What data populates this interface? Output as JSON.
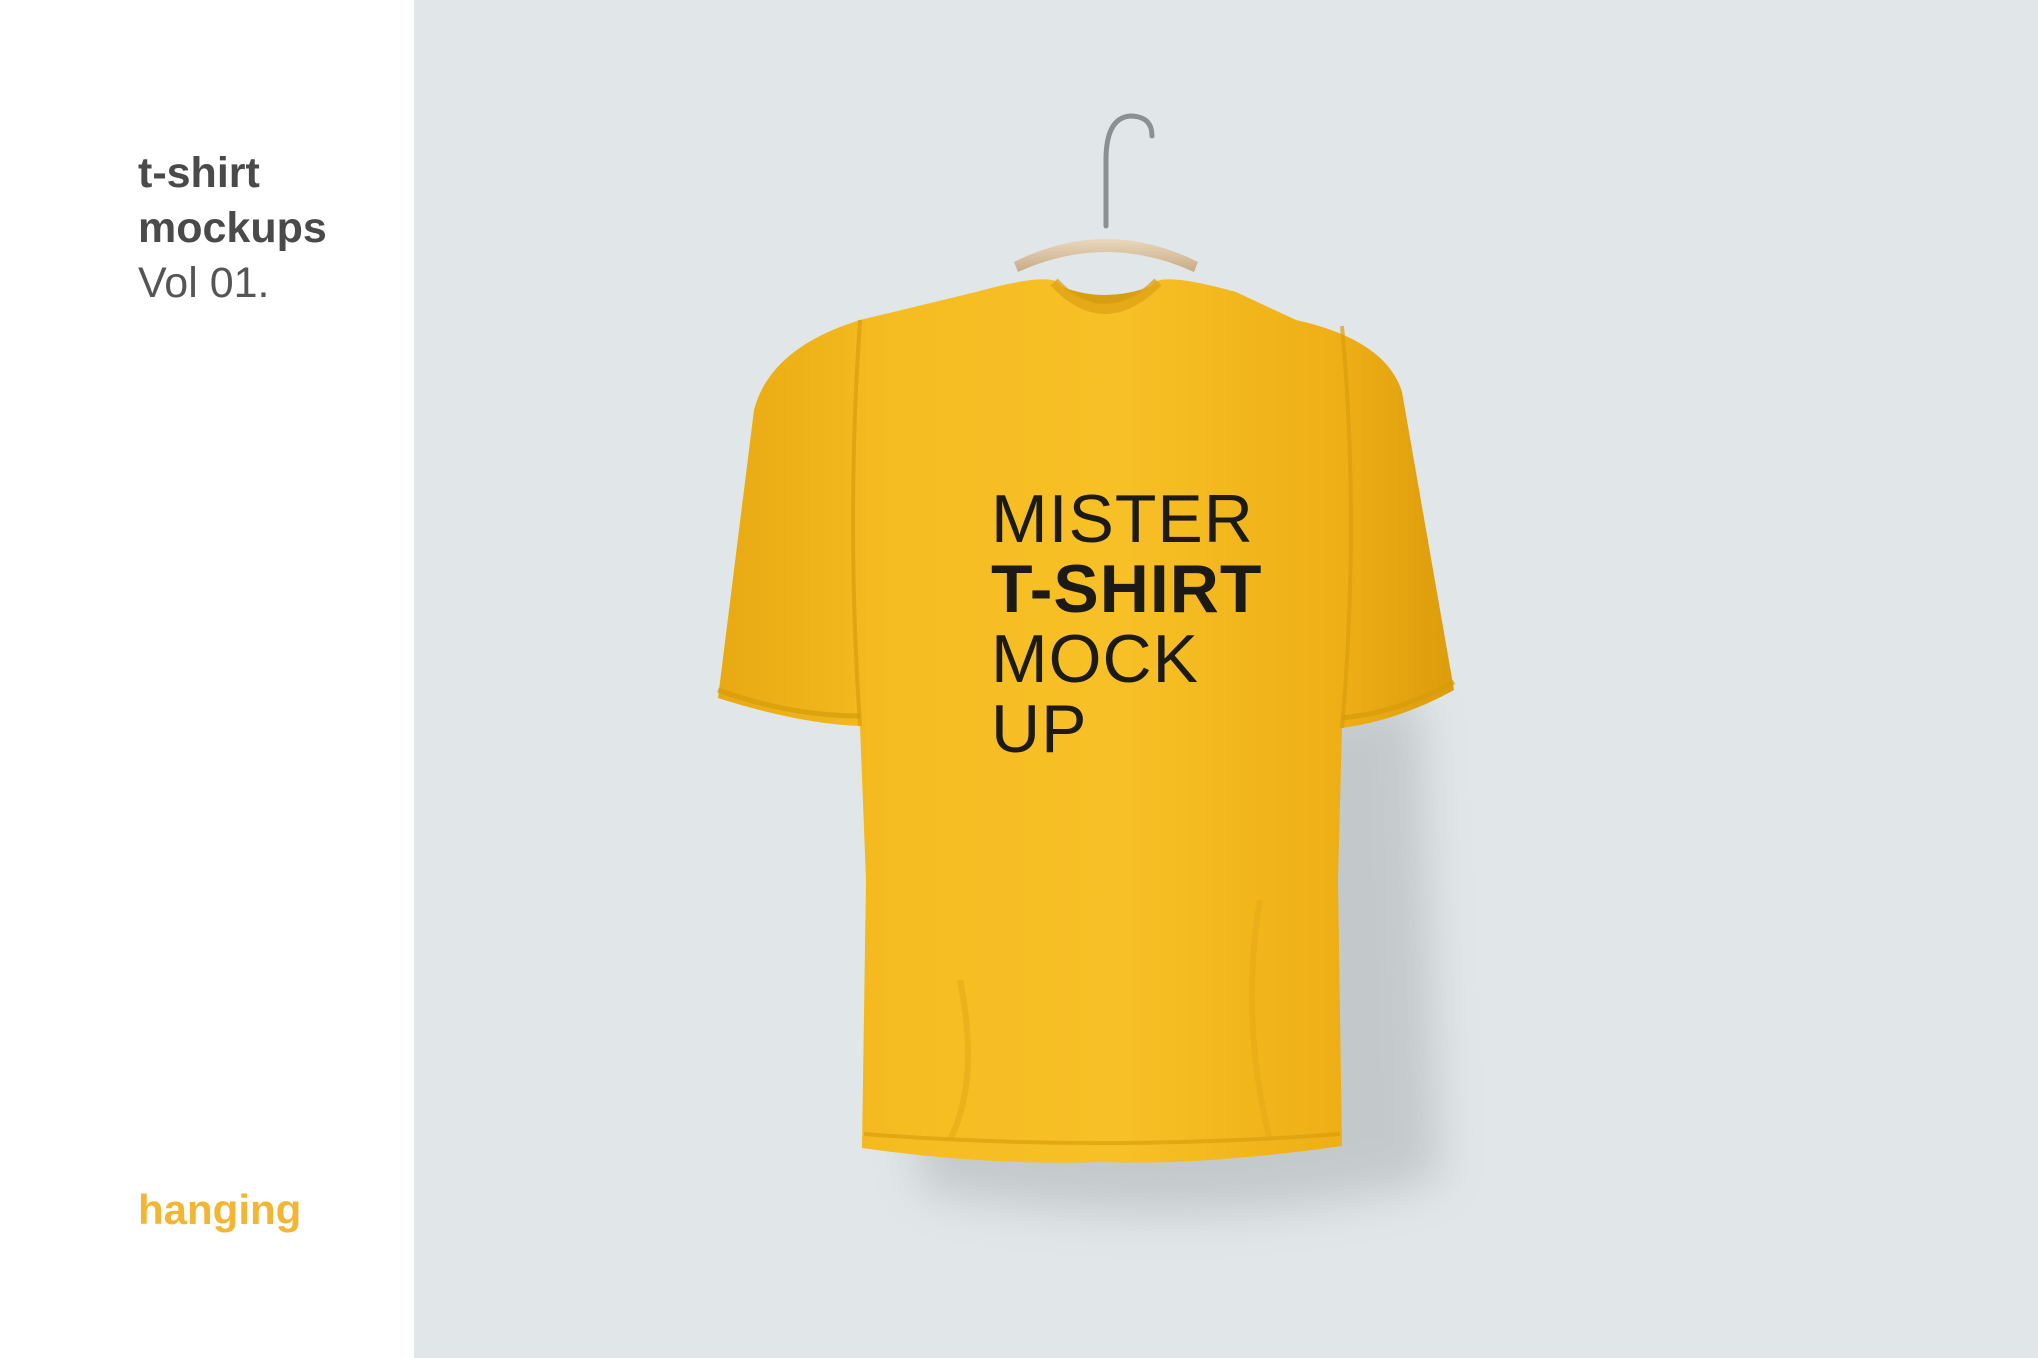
{
  "sidebar": {
    "title_line1": "t-shirt",
    "title_line2": "mockups",
    "title_line3": "Vol 01.",
    "category": "hanging"
  },
  "shirt": {
    "color": "#f4b81c",
    "print_lines": [
      "MISTER",
      "T-SHIRT",
      "MOCK",
      "UP"
    ]
  },
  "colors": {
    "background": "#e1e6e8",
    "accent": "#f2b632",
    "title_text": "#4a4a4a"
  }
}
